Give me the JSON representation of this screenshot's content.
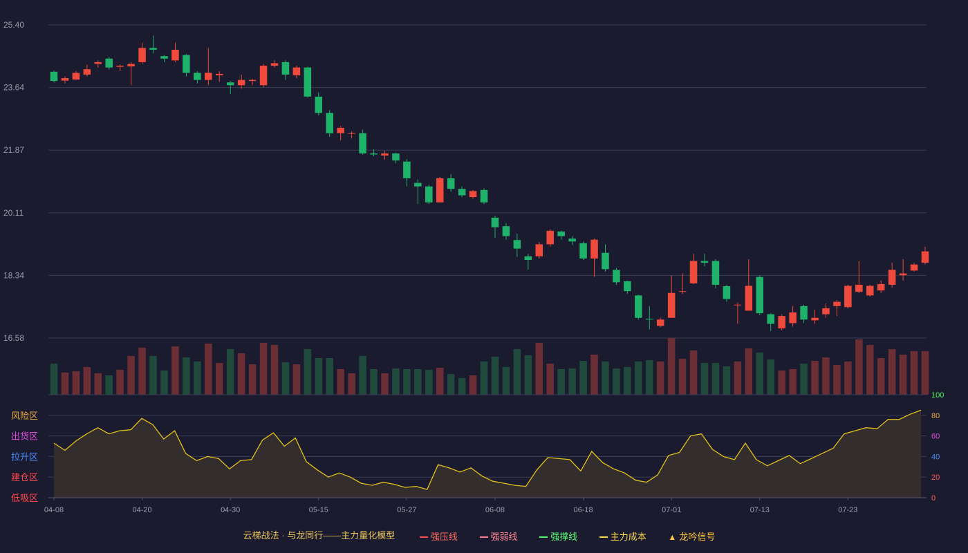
{
  "chart_data": {
    "type": "candlestick",
    "x_tick_labels": [
      "04-08",
      "04-20",
      "04-30",
      "05-15",
      "05-27",
      "06-08",
      "06-18",
      "07-01",
      "07-13",
      "07-23"
    ],
    "x_tick_index": [
      0,
      8,
      16,
      24,
      32,
      40,
      48,
      56,
      64,
      72
    ],
    "price_axis": {
      "ylim": [
        16.58,
        25.4
      ],
      "ticks": [
        "25.40",
        "23.64",
        "21.87",
        "20.11",
        "18.34",
        "16.58"
      ]
    },
    "ohlc": [
      [
        24.08,
        23.82,
        24.12,
        23.78
      ],
      [
        23.83,
        23.9,
        23.95,
        23.75
      ],
      [
        23.86,
        24.05,
        24.1,
        23.85
      ],
      [
        24.0,
        24.15,
        24.28,
        23.95
      ],
      [
        24.3,
        24.35,
        24.4,
        24.2
      ],
      [
        24.45,
        24.2,
        24.5,
        24.15
      ],
      [
        24.22,
        24.25,
        24.28,
        24.1
      ],
      [
        24.23,
        24.3,
        24.35,
        23.7
      ],
      [
        24.35,
        24.75,
        24.9,
        24.3
      ],
      [
        24.75,
        24.7,
        25.1,
        24.6
      ],
      [
        24.52,
        24.45,
        24.55,
        24.35
      ],
      [
        24.4,
        24.7,
        24.9,
        24.35
      ],
      [
        24.55,
        24.05,
        24.58,
        23.95
      ],
      [
        24.05,
        23.85,
        24.1,
        23.75
      ],
      [
        23.85,
        24.05,
        24.75,
        23.7
      ],
      [
        23.98,
        24.02,
        24.1,
        23.8
      ],
      [
        23.78,
        23.7,
        23.82,
        23.45
      ],
      [
        23.7,
        23.85,
        24.0,
        23.6
      ],
      [
        23.82,
        23.85,
        23.88,
        23.7
      ],
      [
        23.7,
        24.25,
        24.3,
        23.65
      ],
      [
        24.25,
        24.32,
        24.4,
        24.2
      ],
      [
        24.35,
        24.0,
        24.4,
        23.85
      ],
      [
        23.98,
        24.2,
        24.25,
        23.9
      ],
      [
        24.2,
        23.38,
        24.22,
        23.35
      ],
      [
        23.38,
        22.92,
        23.5,
        22.85
      ],
      [
        22.92,
        22.35,
        23.0,
        22.25
      ],
      [
        22.35,
        22.5,
        22.55,
        22.15
      ],
      [
        22.33,
        22.35,
        22.4,
        22.2
      ],
      [
        22.35,
        21.78,
        22.45,
        21.75
      ],
      [
        21.78,
        21.75,
        21.9,
        21.7
      ],
      [
        21.72,
        21.78,
        21.85,
        21.6
      ],
      [
        21.78,
        21.58,
        21.8,
        21.5
      ],
      [
        21.55,
        21.08,
        21.62,
        20.85
      ],
      [
        20.95,
        20.85,
        21.05,
        20.35
      ],
      [
        20.85,
        20.4,
        20.9,
        20.35
      ],
      [
        20.4,
        21.08,
        21.12,
        20.4
      ],
      [
        21.08,
        20.78,
        21.2,
        20.7
      ],
      [
        20.78,
        20.6,
        20.85,
        20.55
      ],
      [
        20.55,
        20.72,
        20.75,
        20.5
      ],
      [
        20.75,
        20.4,
        20.8,
        20.35
      ],
      [
        19.97,
        19.7,
        20.02,
        19.4
      ],
      [
        19.73,
        19.45,
        19.82,
        19.35
      ],
      [
        19.34,
        19.1,
        19.52,
        18.87
      ],
      [
        18.88,
        18.78,
        18.95,
        18.5
      ],
      [
        18.88,
        19.22,
        19.28,
        18.82
      ],
      [
        19.22,
        19.6,
        19.65,
        19.15
      ],
      [
        19.58,
        19.45,
        19.6,
        19.35
      ],
      [
        19.38,
        19.3,
        19.45,
        19.2
      ],
      [
        19.25,
        18.82,
        19.3,
        18.78
      ],
      [
        18.82,
        19.35,
        19.38,
        18.3
      ],
      [
        18.98,
        18.52,
        19.22,
        18.45
      ],
      [
        18.5,
        18.15,
        18.55,
        18.08
      ],
      [
        18.18,
        17.9,
        18.2,
        17.82
      ],
      [
        17.78,
        17.15,
        17.8,
        17.1
      ],
      [
        17.12,
        17.1,
        17.48,
        16.82
      ],
      [
        16.92,
        17.1,
        17.15,
        16.88
      ],
      [
        17.15,
        17.85,
        18.34,
        17.15
      ],
      [
        17.88,
        17.9,
        18.4,
        17.82
      ],
      [
        18.12,
        18.75,
        18.95,
        18.1
      ],
      [
        18.75,
        18.7,
        18.95,
        18.6
      ],
      [
        18.75,
        18.08,
        18.8,
        17.98
      ],
      [
        18.04,
        17.68,
        18.08,
        17.6
      ],
      [
        17.52,
        17.52,
        17.58,
        16.98
      ],
      [
        17.35,
        18.05,
        18.8,
        17.35
      ],
      [
        18.3,
        17.28,
        18.35,
        17.22
      ],
      [
        17.25,
        16.98,
        17.28,
        16.78
      ],
      [
        16.85,
        17.2,
        17.25,
        16.8
      ],
      [
        17.0,
        17.3,
        17.48,
        16.9
      ],
      [
        17.48,
        17.1,
        17.52,
        17.0
      ],
      [
        17.08,
        17.15,
        17.38,
        16.98
      ],
      [
        17.25,
        17.42,
        17.55,
        17.15
      ],
      [
        17.48,
        17.6,
        17.65,
        17.2
      ],
      [
        17.45,
        18.05,
        18.08,
        17.42
      ],
      [
        17.88,
        18.08,
        18.75,
        17.85
      ],
      [
        17.78,
        18.05,
        18.08,
        17.75
      ],
      [
        17.92,
        18.1,
        18.2,
        17.85
      ],
      [
        18.08,
        18.5,
        18.7,
        18.0
      ],
      [
        18.35,
        18.4,
        18.8,
        18.2
      ],
      [
        18.48,
        18.65,
        18.7,
        18.45
      ],
      [
        18.7,
        19.02,
        19.15,
        18.65
      ]
    ],
    "volume": [
      45,
      32,
      34,
      40,
      31,
      28,
      36,
      56,
      68,
      56,
      35,
      70,
      54,
      48,
      74,
      46,
      66,
      60,
      44,
      75,
      72,
      47,
      44,
      66,
      53,
      53,
      37,
      31,
      56,
      37,
      31,
      38,
      37,
      37,
      36,
      39,
      30,
      24,
      28,
      48,
      55,
      40,
      66,
      57,
      75,
      45,
      37,
      38,
      49,
      58,
      48,
      38,
      40,
      48,
      50,
      48,
      82,
      52,
      64,
      46,
      46,
      41,
      48,
      67,
      61,
      51,
      35,
      37,
      45,
      49,
      54,
      43,
      48,
      80,
      72,
      53,
      66,
      58,
      63,
      63
    ],
    "volume_ylim": [
      0,
      82
    ],
    "oscillator": {
      "values": [
        53,
        46,
        55,
        62,
        68,
        62,
        65,
        66,
        77,
        71,
        57,
        65,
        43,
        36,
        40,
        38,
        28,
        36,
        37,
        56,
        63,
        50,
        58,
        35,
        27,
        20,
        24,
        20,
        14,
        12,
        15,
        13,
        10,
        11,
        8,
        32,
        29,
        25,
        29,
        21,
        16,
        14,
        12,
        11,
        27,
        39,
        38,
        37,
        26,
        45,
        34,
        28,
        24,
        17,
        15,
        22,
        41,
        44,
        60,
        62,
        47,
        40,
        37,
        53,
        37,
        31,
        36,
        41,
        33,
        38,
        43,
        48,
        62,
        65,
        68,
        67,
        76,
        76,
        81,
        85
      ],
      "ylim": [
        0,
        100
      ],
      "ticks": [
        "100",
        "80",
        "60",
        "40",
        "20",
        "0"
      ],
      "zones": [
        "风险区",
        "出货区",
        "拉升区",
        "建仓区",
        "低吸区"
      ]
    }
  },
  "legend": {
    "title": "云梯战法 · 与龙同行——主力量化模型",
    "items": [
      {
        "label": "强压线",
        "color": "#ff4d4f",
        "style": "solid"
      },
      {
        "label": "强弱线",
        "color": "#ff7a8a",
        "style": "dashed"
      },
      {
        "label": "强撑线",
        "color": "#52ff6b",
        "style": "solid"
      },
      {
        "label": "主力成本",
        "color": "#ffd84d",
        "style": "dashed"
      },
      {
        "label": "龙吟信号",
        "color": "#ffc53d",
        "style": "triangle"
      }
    ]
  },
  "colors": {
    "up": "#ef4a3c",
    "down": "#1fb26a",
    "vol_up": "#6a2e34",
    "vol_down": "#1f4a3c",
    "grid": "#3a3c52",
    "axis_text": "#9a9cab",
    "osc_line": "#e4c21a",
    "osc_fill": "#36302e",
    "zone_colors": [
      "#e8a93a",
      "#e04fe0",
      "#4a8fff",
      "#ff4a4a",
      "#ff4a4a"
    ],
    "osc_tick_colors": [
      "#3cff5a",
      "#e8a93a",
      "#e04fe0",
      "#4a8fff",
      "#ff5a5a",
      "#ff5a5a"
    ]
  }
}
